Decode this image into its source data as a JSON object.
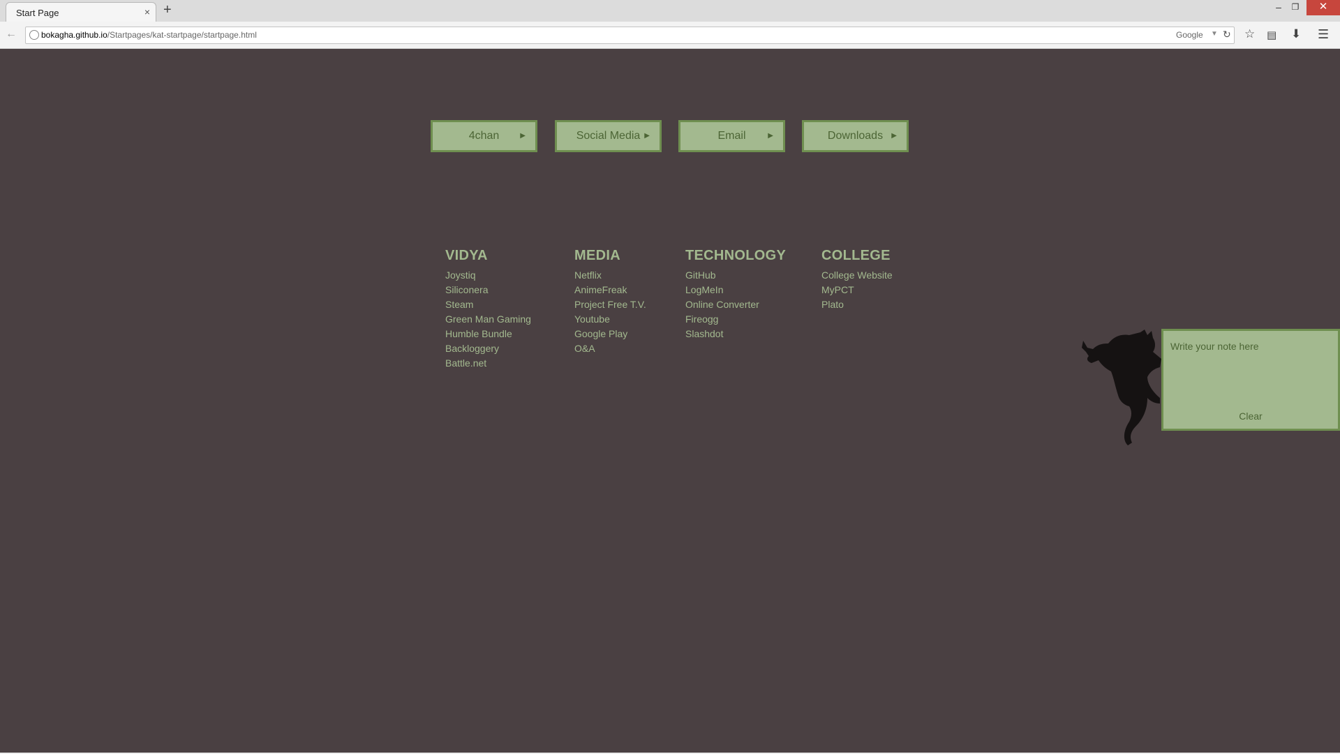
{
  "browser": {
    "tab_title": "Start Page",
    "tab_close": "×",
    "new_tab": "+",
    "url_host": "bokagha.github.io",
    "url_path": "/Startpages/kat-startpage/startpage.html",
    "search_engine": "Google",
    "window_controls": {
      "minimize": "–",
      "maximize": "❐",
      "close": "✕"
    },
    "icons": [
      "back-arrow-icon",
      "site-info-icon",
      "reload-icon",
      "bookmark-star-icon",
      "bookmarks-list-icon",
      "download-icon",
      "menu-icon"
    ]
  },
  "dropdowns": [
    {
      "label": "4chan"
    },
    {
      "label": "Social Media"
    },
    {
      "label": "Email"
    },
    {
      "label": "Downloads"
    }
  ],
  "columns": {
    "vidya": {
      "title": "VIDYA",
      "links": [
        "Joystiq",
        "Siliconera",
        "Steam",
        "Green Man Gaming",
        "Humble Bundle",
        "Backloggery",
        "Battle.net"
      ]
    },
    "media": {
      "title": "MEDIA",
      "links": [
        "Netflix",
        "AnimeFreak",
        "Project Free T.V.",
        "Youtube",
        "Google Play",
        "O&A"
      ]
    },
    "tech": {
      "title": "TECHNOLOGY",
      "links": [
        "GitHub",
        "LogMeIn",
        "Online Converter",
        "Fireogg",
        "Slashdot"
      ]
    },
    "college": {
      "title": "COLLEGE",
      "links": [
        "College Website",
        "MyPCT",
        "Plato"
      ]
    }
  },
  "note": {
    "placeholder": "Write your note here",
    "clear_label": "Clear"
  },
  "colors": {
    "background": "#4a4042",
    "accent": "#a3b98f",
    "accent_border": "#6f8f50",
    "accent_text": "#4c6535"
  }
}
